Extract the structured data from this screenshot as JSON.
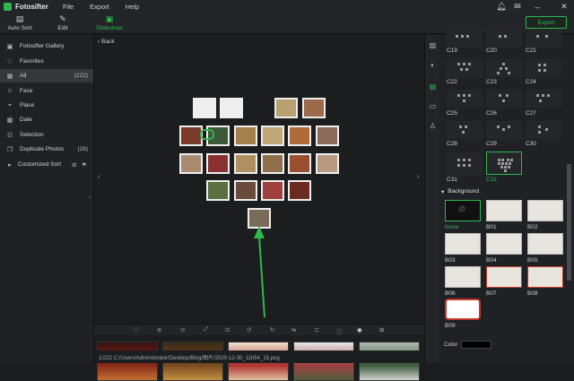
{
  "app": {
    "name": "Fotosifter"
  },
  "menu": {
    "file": "File",
    "export": "Export",
    "help": "Help"
  },
  "toolbar": {
    "auto_sort": "Auto Sort",
    "edit": "Edit",
    "slideshow": "Slideshow",
    "export_button": "Export"
  },
  "sidebar": {
    "items": [
      {
        "label": "Fotosifter Gallery",
        "icon": "gallery-icon"
      },
      {
        "label": "Favorites",
        "icon": "heart-icon"
      },
      {
        "label": "All",
        "count": "(222)",
        "icon": "grid-icon"
      },
      {
        "label": "Face",
        "icon": "face-icon"
      },
      {
        "label": "Place",
        "icon": "pin-icon"
      },
      {
        "label": "Date",
        "icon": "calendar-icon"
      },
      {
        "label": "Selection",
        "icon": "selection-icon"
      },
      {
        "label": "Duplicate Photos",
        "count": "(28)",
        "icon": "duplicate-icon"
      },
      {
        "label": "Customized Sort",
        "icon": "caret-right-icon"
      }
    ]
  },
  "center": {
    "back_label": "Back",
    "status_path": "1/222  C:/Users/Administrator/Desktop/Blog/图片/2020-12-30_11h54_15.png"
  },
  "layouts": {
    "labels": [
      "C19",
      "C20",
      "C21",
      "C22",
      "C23",
      "C24",
      "C25",
      "C26",
      "C27",
      "C28",
      "C29",
      "C30",
      "C31",
      "C32"
    ],
    "selected": "C32"
  },
  "background": {
    "header": "Background",
    "labels": [
      "None",
      "B01",
      "B02",
      "B03",
      "B04",
      "B05",
      "B06",
      "B07",
      "B08",
      "B09"
    ],
    "selected": "None"
  },
  "color": {
    "label": "Color",
    "value": "#000000"
  },
  "colors": {
    "accent": "#2db84d",
    "panel": "#202124",
    "canvas": "#1c1d1f"
  }
}
